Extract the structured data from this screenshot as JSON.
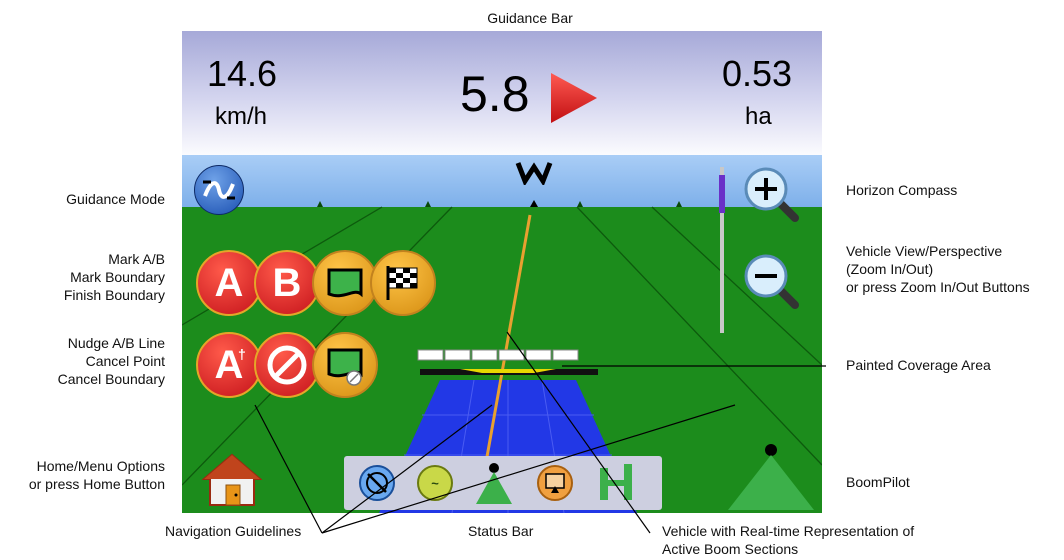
{
  "callouts": {
    "guidance_bar": "Guidance Bar",
    "guidance_mode": "Guidance Mode",
    "mark_ab": "Mark A/B",
    "mark_boundary": "Mark Boundary",
    "finish_boundary": "Finish Boundary",
    "nudge_ab": "Nudge A/B Line",
    "cancel_point": "Cancel Point",
    "cancel_boundary": "Cancel Boundary",
    "home_menu_1": "Home/Menu Options",
    "home_menu_2": "or press Home Button",
    "horizon_compass": "Horizon Compass",
    "vehicle_view_1": "Vehicle View/Perspective",
    "vehicle_view_2": "(Zoom In/Out)",
    "vehicle_view_3": "or press Zoom In/Out Buttons",
    "painted_coverage": "Painted Coverage Area",
    "boompilot": "BoomPilot",
    "navigation_guidelines": "Navigation Guidelines",
    "status_bar": "Status Bar",
    "vehicle_realtime_1": "Vehicle with Real-time Representation of",
    "vehicle_realtime_2": "Active Boom Sections"
  },
  "guidance": {
    "speed_value": "14.6",
    "speed_unit": "km/h",
    "cross_track": "5.8",
    "area_value": "0.53",
    "area_unit": "ha",
    "direction_arrow": "right-arrow"
  },
  "compass": {
    "heading": "W"
  },
  "buttons": {
    "mark_a": "A",
    "mark_b": "B",
    "nudge": "A"
  },
  "colors": {
    "sky": "#8fb9ec",
    "field": "#1c8c1c",
    "coverage": "#2336e8",
    "button_red": "#d8222a",
    "button_gold": "#e5a628",
    "status_green": "#2aa84a"
  }
}
